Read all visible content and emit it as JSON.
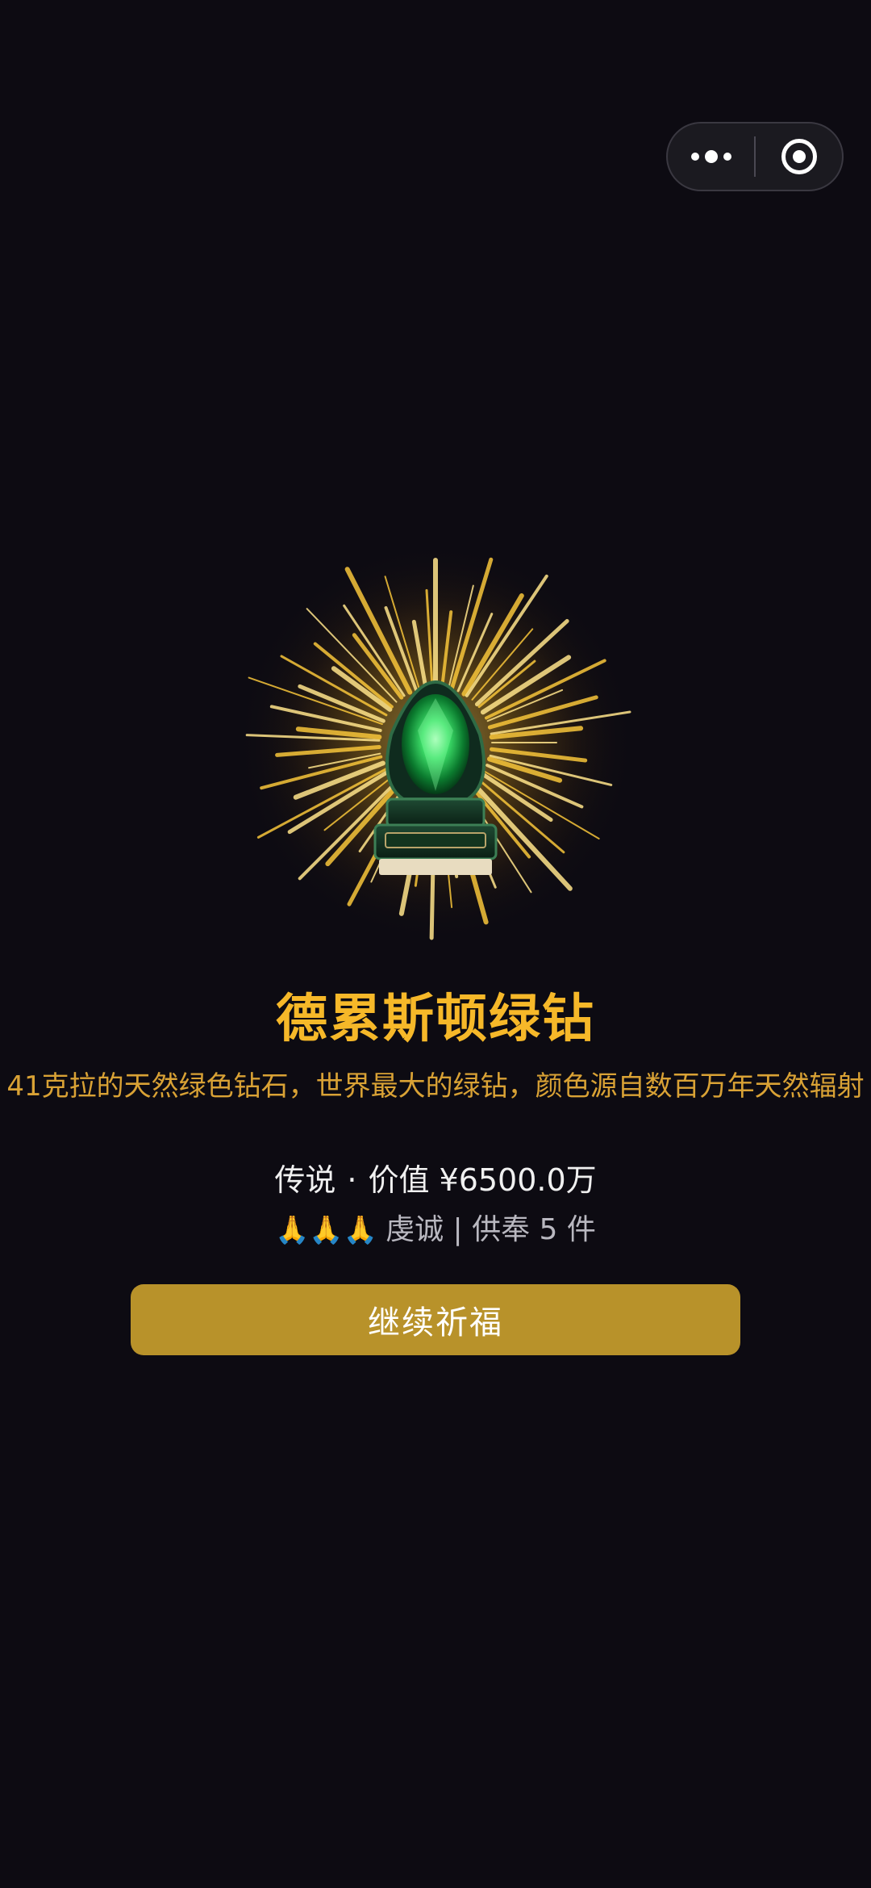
{
  "capsule": {
    "more_icon": "more-dots-icon",
    "close_icon": "target-icon"
  },
  "item": {
    "image_icon": "green-diamond-legendary-icon",
    "title": "德累斯顿绿钻",
    "description": "41克拉的天然绿色钻石，世界最大的绿钻，颜色源自数百万年天然辐射",
    "rarity": "传说",
    "separator": "·",
    "value_label": "价值 ¥6500.0万",
    "devotion_hands": "🙏🙏🙏",
    "devotion_text": "虔诚 | 供奉 5 件"
  },
  "actions": {
    "continue_label": "继续祈福"
  },
  "colors": {
    "background": "#0d0b12",
    "title": "#f6b829",
    "description": "#d9a235",
    "button": "#b8922a"
  }
}
